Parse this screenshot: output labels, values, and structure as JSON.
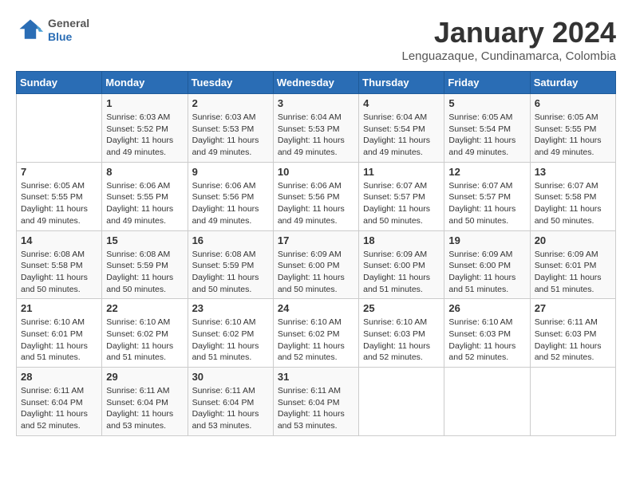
{
  "header": {
    "logo_general": "General",
    "logo_blue": "Blue",
    "month_title": "January 2024",
    "location": "Lenguazaque, Cundinamarca, Colombia"
  },
  "weekdays": [
    "Sunday",
    "Monday",
    "Tuesday",
    "Wednesday",
    "Thursday",
    "Friday",
    "Saturday"
  ],
  "weeks": [
    [
      {
        "day": "",
        "info": ""
      },
      {
        "day": "1",
        "info": "Sunrise: 6:03 AM\nSunset: 5:52 PM\nDaylight: 11 hours\nand 49 minutes."
      },
      {
        "day": "2",
        "info": "Sunrise: 6:03 AM\nSunset: 5:53 PM\nDaylight: 11 hours\nand 49 minutes."
      },
      {
        "day": "3",
        "info": "Sunrise: 6:04 AM\nSunset: 5:53 PM\nDaylight: 11 hours\nand 49 minutes."
      },
      {
        "day": "4",
        "info": "Sunrise: 6:04 AM\nSunset: 5:54 PM\nDaylight: 11 hours\nand 49 minutes."
      },
      {
        "day": "5",
        "info": "Sunrise: 6:05 AM\nSunset: 5:54 PM\nDaylight: 11 hours\nand 49 minutes."
      },
      {
        "day": "6",
        "info": "Sunrise: 6:05 AM\nSunset: 5:55 PM\nDaylight: 11 hours\nand 49 minutes."
      }
    ],
    [
      {
        "day": "7",
        "info": "Sunrise: 6:05 AM\nSunset: 5:55 PM\nDaylight: 11 hours\nand 49 minutes."
      },
      {
        "day": "8",
        "info": "Sunrise: 6:06 AM\nSunset: 5:55 PM\nDaylight: 11 hours\nand 49 minutes."
      },
      {
        "day": "9",
        "info": "Sunrise: 6:06 AM\nSunset: 5:56 PM\nDaylight: 11 hours\nand 49 minutes."
      },
      {
        "day": "10",
        "info": "Sunrise: 6:06 AM\nSunset: 5:56 PM\nDaylight: 11 hours\nand 49 minutes."
      },
      {
        "day": "11",
        "info": "Sunrise: 6:07 AM\nSunset: 5:57 PM\nDaylight: 11 hours\nand 50 minutes."
      },
      {
        "day": "12",
        "info": "Sunrise: 6:07 AM\nSunset: 5:57 PM\nDaylight: 11 hours\nand 50 minutes."
      },
      {
        "day": "13",
        "info": "Sunrise: 6:07 AM\nSunset: 5:58 PM\nDaylight: 11 hours\nand 50 minutes."
      }
    ],
    [
      {
        "day": "14",
        "info": "Sunrise: 6:08 AM\nSunset: 5:58 PM\nDaylight: 11 hours\nand 50 minutes."
      },
      {
        "day": "15",
        "info": "Sunrise: 6:08 AM\nSunset: 5:59 PM\nDaylight: 11 hours\nand 50 minutes."
      },
      {
        "day": "16",
        "info": "Sunrise: 6:08 AM\nSunset: 5:59 PM\nDaylight: 11 hours\nand 50 minutes."
      },
      {
        "day": "17",
        "info": "Sunrise: 6:09 AM\nSunset: 6:00 PM\nDaylight: 11 hours\nand 50 minutes."
      },
      {
        "day": "18",
        "info": "Sunrise: 6:09 AM\nSunset: 6:00 PM\nDaylight: 11 hours\nand 51 minutes."
      },
      {
        "day": "19",
        "info": "Sunrise: 6:09 AM\nSunset: 6:00 PM\nDaylight: 11 hours\nand 51 minutes."
      },
      {
        "day": "20",
        "info": "Sunrise: 6:09 AM\nSunset: 6:01 PM\nDaylight: 11 hours\nand 51 minutes."
      }
    ],
    [
      {
        "day": "21",
        "info": "Sunrise: 6:10 AM\nSunset: 6:01 PM\nDaylight: 11 hours\nand 51 minutes."
      },
      {
        "day": "22",
        "info": "Sunrise: 6:10 AM\nSunset: 6:02 PM\nDaylight: 11 hours\nand 51 minutes."
      },
      {
        "day": "23",
        "info": "Sunrise: 6:10 AM\nSunset: 6:02 PM\nDaylight: 11 hours\nand 51 minutes."
      },
      {
        "day": "24",
        "info": "Sunrise: 6:10 AM\nSunset: 6:02 PM\nDaylight: 11 hours\nand 52 minutes."
      },
      {
        "day": "25",
        "info": "Sunrise: 6:10 AM\nSunset: 6:03 PM\nDaylight: 11 hours\nand 52 minutes."
      },
      {
        "day": "26",
        "info": "Sunrise: 6:10 AM\nSunset: 6:03 PM\nDaylight: 11 hours\nand 52 minutes."
      },
      {
        "day": "27",
        "info": "Sunrise: 6:11 AM\nSunset: 6:03 PM\nDaylight: 11 hours\nand 52 minutes."
      }
    ],
    [
      {
        "day": "28",
        "info": "Sunrise: 6:11 AM\nSunset: 6:04 PM\nDaylight: 11 hours\nand 52 minutes."
      },
      {
        "day": "29",
        "info": "Sunrise: 6:11 AM\nSunset: 6:04 PM\nDaylight: 11 hours\nand 53 minutes."
      },
      {
        "day": "30",
        "info": "Sunrise: 6:11 AM\nSunset: 6:04 PM\nDaylight: 11 hours\nand 53 minutes."
      },
      {
        "day": "31",
        "info": "Sunrise: 6:11 AM\nSunset: 6:04 PM\nDaylight: 11 hours\nand 53 minutes."
      },
      {
        "day": "",
        "info": ""
      },
      {
        "day": "",
        "info": ""
      },
      {
        "day": "",
        "info": ""
      }
    ]
  ]
}
